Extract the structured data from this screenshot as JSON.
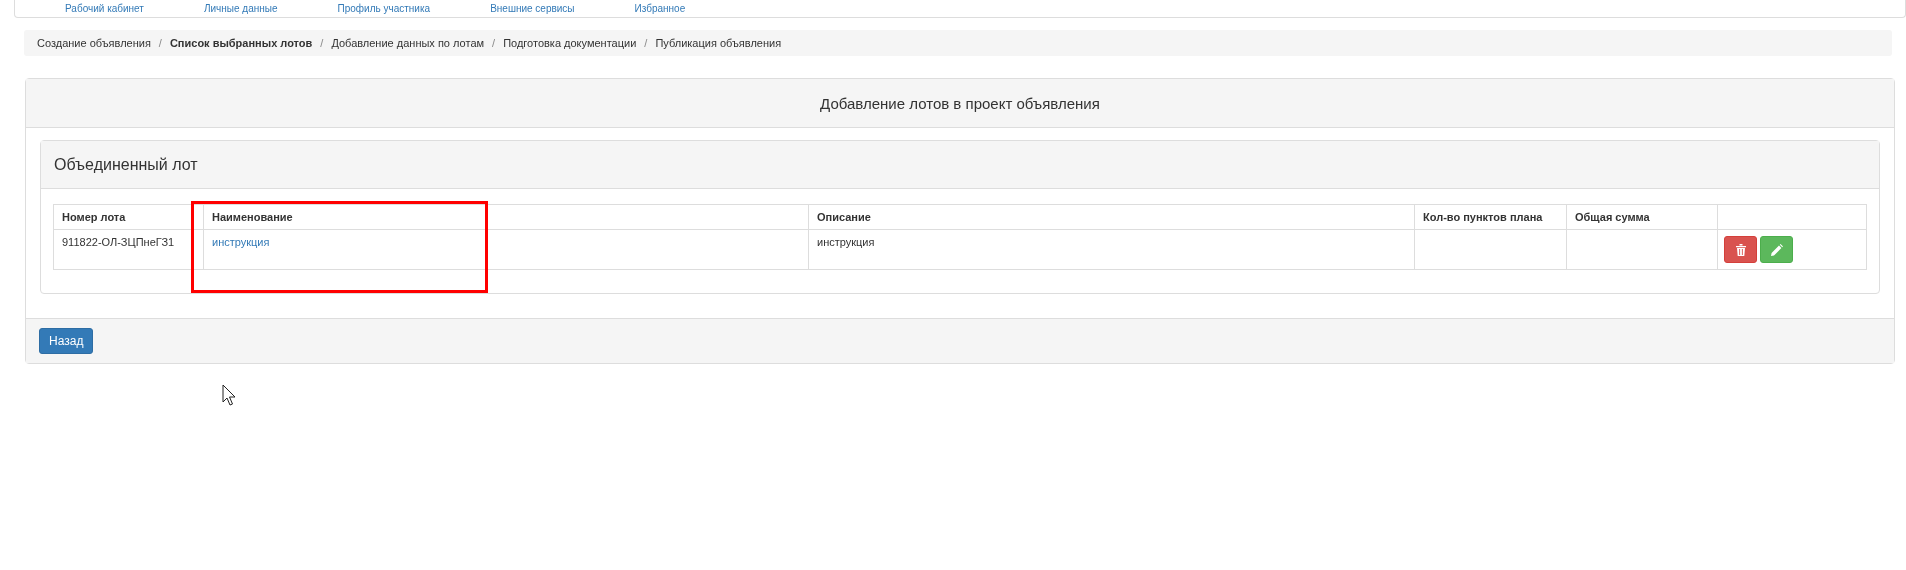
{
  "nav": {
    "items": [
      {
        "label": "Рабочий кабинет"
      },
      {
        "label": "Личные данные"
      },
      {
        "label": "Профиль участника"
      },
      {
        "label": "Внешние сервисы"
      },
      {
        "label": "Избранное"
      }
    ]
  },
  "breadcrumb": [
    {
      "label": "Создание объявления",
      "selected": false
    },
    {
      "separator": "/",
      "label": "Список выбранных лотов",
      "selected": true
    },
    {
      "separator": "/",
      "label": "Добавление данных по лотам",
      "selected": false
    },
    {
      "separator": "/",
      "label": "Подготовка документации",
      "selected": false
    },
    {
      "separator": "/",
      "label": "Публикация объявления",
      "selected": false
    }
  ],
  "panel": {
    "title": "Добавление лотов в проект объявления",
    "lot_panel": {
      "title": "Объединенный лот",
      "table": {
        "columns": [
          "Номер лота",
          "Наименование",
          "Описание",
          "Кол-во пунктов плана",
          "Общая сумма"
        ],
        "rows": [
          {
            "number": "911822-ОЛ-ЗЦПнеГЗ1",
            "name": "инструкция",
            "description": "инструкция"
          }
        ]
      }
    },
    "back_button": "Назад"
  }
}
